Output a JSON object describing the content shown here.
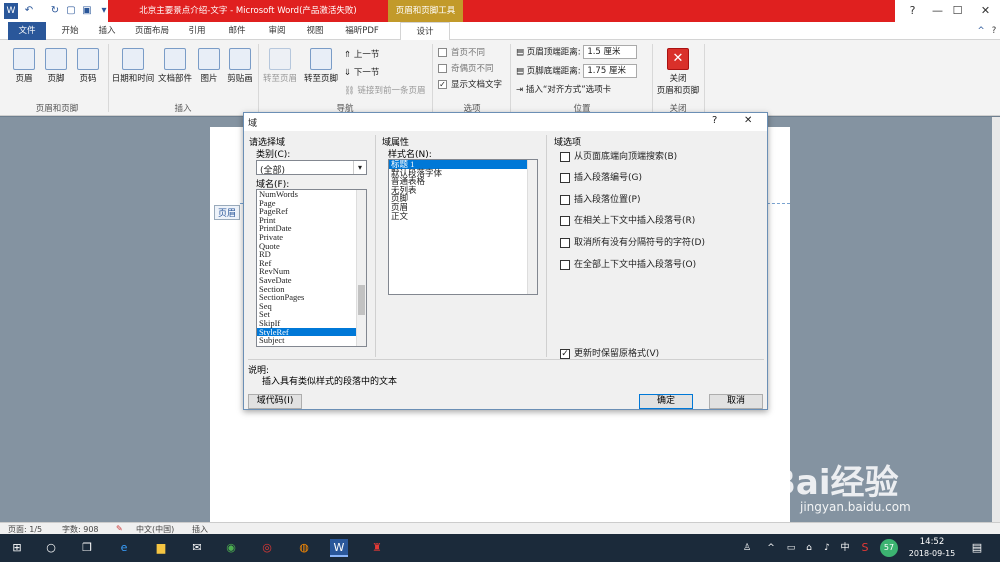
{
  "window": {
    "title": "北京主要景点介绍-文字 - Microsoft Word(产品激活失败)",
    "context_tool": "页眉和页脚工具",
    "controls": [
      "?",
      "—",
      "☐",
      "✕"
    ]
  },
  "tabs": [
    "文件",
    "开始",
    "插入",
    "页面布局",
    "引用",
    "邮件",
    "审阅",
    "视图",
    "福昕PDF",
    "设计"
  ],
  "ribbon": {
    "header_footer": {
      "items": [
        "页眉",
        "页脚",
        "页码"
      ],
      "group": "页眉和页脚"
    },
    "insert": {
      "items": [
        "日期和时间",
        "文档部件",
        "图片",
        "剪贴画"
      ],
      "group": "插入"
    },
    "nav": {
      "items": [
        "转至页眉",
        "转至页脚"
      ],
      "small": [
        "上一节",
        "下一节",
        "链接到前一条页眉"
      ],
      "group": "导航"
    },
    "options": {
      "items": [
        "首页不同",
        "奇偶页不同",
        "显示文档文字"
      ],
      "checked": [
        false,
        false,
        true
      ],
      "group": "选项"
    },
    "position": {
      "header_label": "页眉顶端距离:",
      "header_value": "1.5 厘米",
      "footer_label": "页脚底端距离:",
      "footer_value": "1.75 厘米",
      "tab_label": "插入“对齐方式”选项卡",
      "group": "位置"
    },
    "close": {
      "label1": "关闭",
      "label2": "页眉和页脚",
      "group": "关闭"
    }
  },
  "doc": {
    "header_tag": "页眉"
  },
  "dialog": {
    "title": "域",
    "help": "?",
    "close": "✕",
    "choose_field": "请选择域",
    "category_label": "类别(C):",
    "category_value": "(全部)",
    "field_names_label": "域名(F):",
    "field_names": [
      "NumWords",
      "Page",
      "PageRef",
      "Print",
      "PrintDate",
      "Private",
      "Quote",
      "RD",
      "Ref",
      "RevNum",
      "SaveDate",
      "Section",
      "SectionPages",
      "Seq",
      "Set",
      "SkipIf",
      "StyleRef",
      "Subject"
    ],
    "selected_field": "StyleRef",
    "props_title": "域属性",
    "style_name_label": "样式名(N):",
    "style_names": [
      "标题 1",
      "默认段落字体",
      "普通表格",
      "无列表",
      "页脚",
      "页眉",
      "正文"
    ],
    "selected_style": "标题 1",
    "options_title": "域选项",
    "options": [
      "从页面底端向顶端搜索(B)",
      "插入段落编号(G)",
      "插入段落位置(P)",
      "在相关上下文中插入段落号(R)",
      "取消所有没有分隔符号的字符(D)",
      "在全部上下文中插入段落号(O)"
    ],
    "preserve": "更新时保留原格式(V)",
    "desc_label": "说明:",
    "desc_text": "插入具有类似样式的段落中的文本",
    "codes_button": "域代码(I)",
    "ok": "确定",
    "cancel": "取消"
  },
  "status": {
    "page": "页面: 1/5",
    "words": "字数: 908",
    "lang": "中文(中国)",
    "mode": "插入"
  },
  "taskbar": {
    "time": "14:52",
    "date": "2018-09-15",
    "ime": "中",
    "badge": "57"
  },
  "watermark": {
    "brand": "Bai经验",
    "url": "jingyan.baidu.com"
  }
}
